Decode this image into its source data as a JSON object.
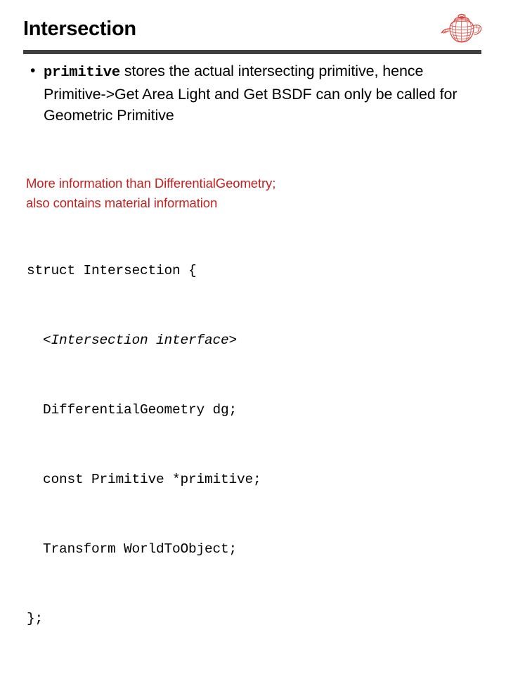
{
  "slide": {
    "title": "Intersection",
    "logo_icon": "wireframe-teapot-icon",
    "accent_color": "#c32020",
    "rule_color": "#404040"
  },
  "bullet": {
    "marker": "•",
    "code_term": "primitive",
    "text_after_term": " stores the actual intersecting primitive, hence Primitive->Get Area Light and Get BSDF can only be called for Geometric Primitive",
    "lines": [
      "stores the actual intersecting",
      "primitive, hence Primitive->GetAreaLight and",
      "GetBSDF can only be called for",
      "GeometricPrimitive"
    ]
  },
  "red_note": {
    "line1": "More information than DifferentialGeometry;",
    "line2": "also contains material information"
  },
  "code": {
    "lines": [
      {
        "text": "struct Intersection {",
        "italic": false
      },
      {
        "text": "  <Intersection interface>",
        "italic": true
      },
      {
        "text": "  DifferentialGeometry dg;",
        "italic": false
      },
      {
        "text": "  const Primitive *primitive;",
        "italic": false
      },
      {
        "text": "  Transform WorldToObject;",
        "italic": false
      },
      {
        "text": "};",
        "italic": false
      }
    ]
  }
}
